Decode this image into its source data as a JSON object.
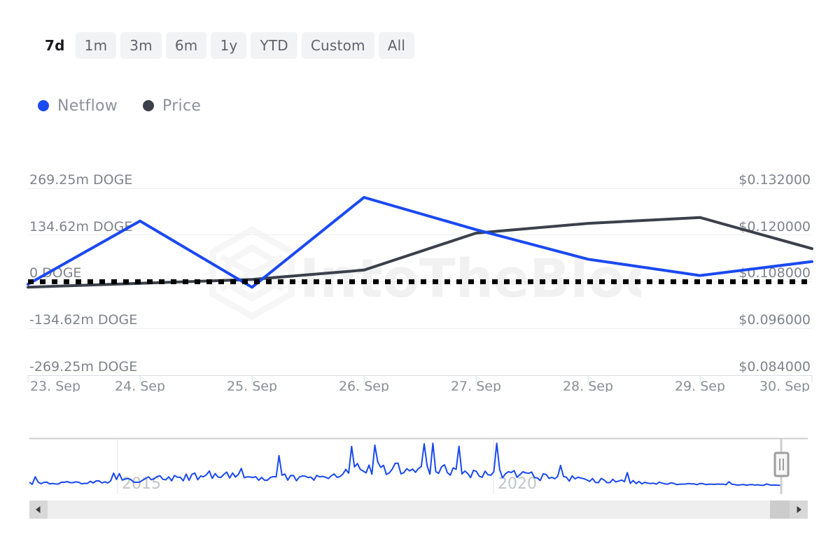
{
  "range_selector": {
    "options": [
      {
        "label": "7d",
        "selected": true
      },
      {
        "label": "1m",
        "selected": false
      },
      {
        "label": "3m",
        "selected": false
      },
      {
        "label": "6m",
        "selected": false
      },
      {
        "label": "1y",
        "selected": false
      },
      {
        "label": "YTD",
        "selected": false
      },
      {
        "label": "Custom",
        "selected": false
      },
      {
        "label": "All",
        "selected": false
      }
    ]
  },
  "legend": {
    "items": [
      {
        "label": "Netflow",
        "color": "#1a49f0",
        "icon": "circle-dot-icon"
      },
      {
        "label": "Price",
        "color": "#3b404a",
        "icon": "circle-dot-icon"
      }
    ]
  },
  "watermark": {
    "text": "IntoTheBlock",
    "logo": "intotheblock-cube-logo"
  },
  "navigator": {
    "year_labels": [
      "2015",
      "2020"
    ],
    "handle": "navigator-right-handle",
    "left_arrow": "◀",
    "right_arrow": "▶"
  },
  "chart_data": {
    "type": "line",
    "title": "",
    "xlabel": "",
    "grid": true,
    "legend_position": "top-left",
    "categories": [
      "23. Sep",
      "24. Sep",
      "25. Sep",
      "26. Sep",
      "27. Sep",
      "28. Sep",
      "29. Sep",
      "30. Sep"
    ],
    "axes": {
      "left": {
        "label": "Netflow",
        "ticks": [
          "269.25m DOGE",
          "134.62m DOGE",
          "0 DOGE",
          "-134.62m DOGE",
          "-269.25m DOGE"
        ],
        "tick_values": [
          269250000,
          134620000,
          0,
          -134620000,
          -269250000
        ],
        "ylim": [
          -269250000,
          269250000
        ]
      },
      "right": {
        "label": "Price",
        "ticks": [
          "$0.132000",
          "$0.120000",
          "$0.108000",
          "$0.096000",
          "$0.084000"
        ],
        "tick_values": [
          0.132,
          0.12,
          0.108,
          0.096,
          0.084
        ],
        "ylim": [
          0.084,
          0.132
        ]
      }
    },
    "zero_line": {
      "value": 0,
      "style": "dotted",
      "color": "#000000"
    },
    "series": [
      {
        "name": "Netflow",
        "color": "#1a49f0",
        "axis": "left",
        "unit": "DOGE",
        "values": [
          -7000000,
          175000000,
          -16000000,
          243000000,
          150000000,
          65000000,
          18000000,
          58000000
        ]
      },
      {
        "name": "Price",
        "color": "#3b404a",
        "axis": "right",
        "unit": "USD",
        "values": [
          0.1066,
          0.1076,
          0.1086,
          0.111,
          0.1205,
          0.123,
          0.1245,
          0.1165
        ]
      }
    ]
  }
}
